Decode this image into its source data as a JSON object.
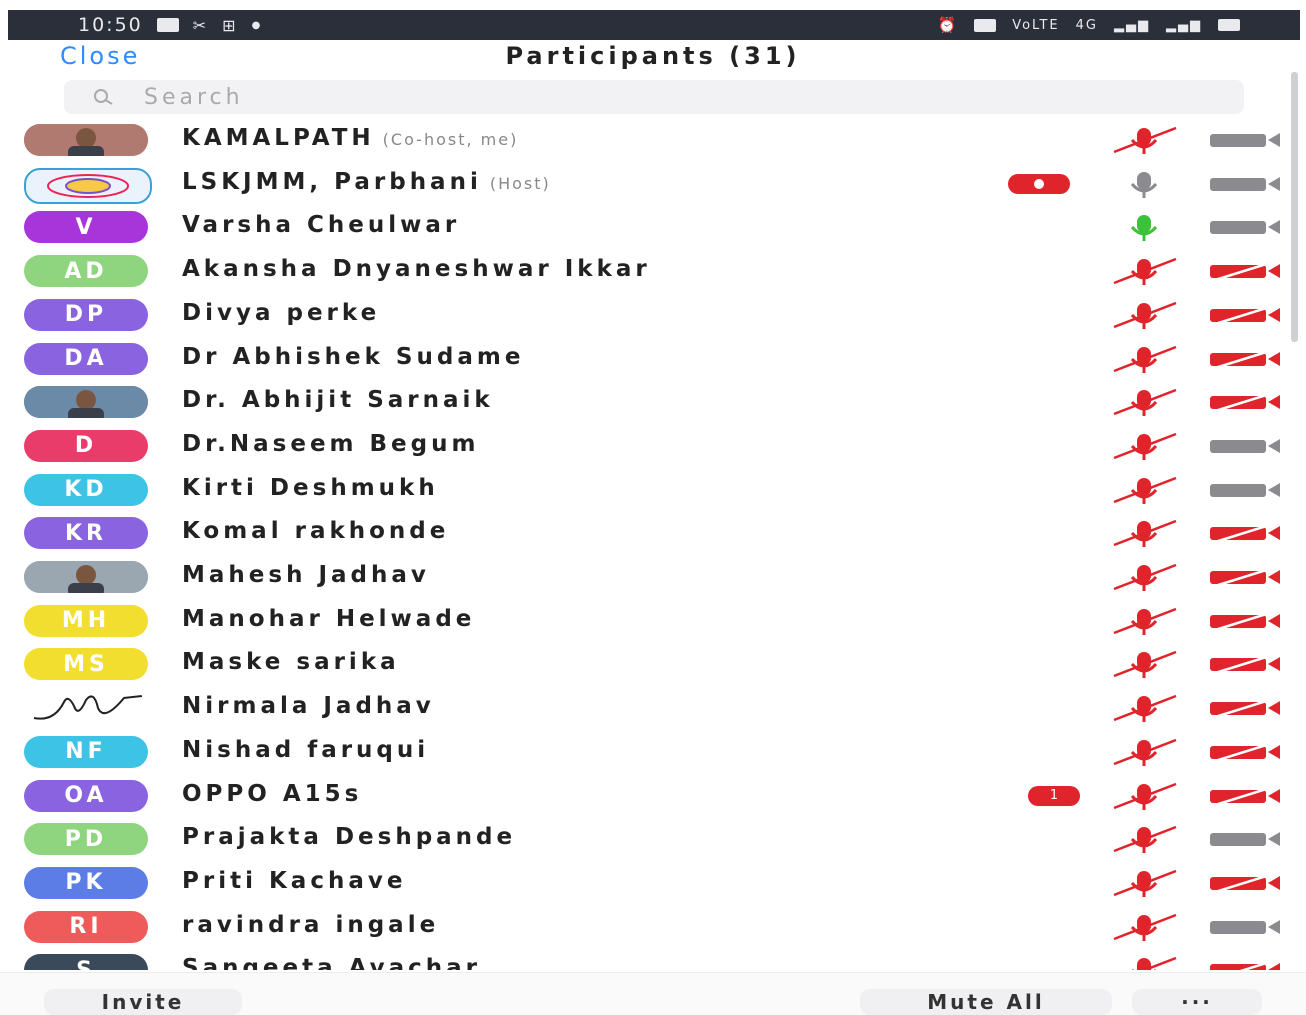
{
  "status_bar": {
    "time": "10:50",
    "network": "VoLTE",
    "signal_gen": "4G"
  },
  "header": {
    "close_label": "Close",
    "title": "Participants (31)"
  },
  "search": {
    "placeholder": "Search"
  },
  "colors": {
    "accent_blue": "#2d8cff",
    "muted_red": "#e0242b",
    "active_green": "#3cc13b",
    "neutral_grey": "#8a8a8f"
  },
  "participants": [
    {
      "name": "KAMALPATH",
      "role": "(Co-host, me)",
      "avatar_text": "",
      "avatar_color": "#b07a70",
      "avatar_kind": "photo-1",
      "badge": "",
      "mic": "muted",
      "video": "on"
    },
    {
      "name": "LSKJMM, Parbhani",
      "role": "(Host)",
      "avatar_text": "",
      "avatar_color": "#eaf3fb",
      "avatar_kind": "logo",
      "badge": "rec",
      "mic": "idle",
      "video": "on"
    },
    {
      "name": "Varsha Cheulwar",
      "role": "",
      "avatar_text": "V",
      "avatar_color": "#a735d9",
      "badge": "",
      "mic": "active",
      "video": "on"
    },
    {
      "name": "Akansha Dnyaneshwar Ikkar",
      "role": "",
      "avatar_text": "AD",
      "avatar_color": "#8fd47e",
      "badge": "",
      "mic": "muted",
      "video": "off"
    },
    {
      "name": "Divya perke",
      "role": "",
      "avatar_text": "DP",
      "avatar_color": "#8a63e0",
      "badge": "",
      "mic": "muted",
      "video": "off"
    },
    {
      "name": "Dr Abhishek Sudame",
      "role": "",
      "avatar_text": "DA",
      "avatar_color": "#8a63e0",
      "badge": "",
      "mic": "muted",
      "video": "off"
    },
    {
      "name": "Dr. Abhijit Sarnaik",
      "role": "",
      "avatar_text": "",
      "avatar_color": "#6a8aa8",
      "avatar_kind": "photo-2",
      "badge": "",
      "mic": "muted",
      "video": "off"
    },
    {
      "name": "Dr.Naseem Begum",
      "role": "",
      "avatar_text": "D",
      "avatar_color": "#ea3c6b",
      "badge": "",
      "mic": "muted",
      "video": "on"
    },
    {
      "name": "Kirti Deshmukh",
      "role": "",
      "avatar_text": "KD",
      "avatar_color": "#3cc3e6",
      "badge": "",
      "mic": "muted",
      "video": "on"
    },
    {
      "name": "Komal rakhonde",
      "role": "",
      "avatar_text": "KR",
      "avatar_color": "#8a63e0",
      "badge": "",
      "mic": "muted",
      "video": "off"
    },
    {
      "name": "Mahesh Jadhav",
      "role": "",
      "avatar_text": "",
      "avatar_color": "#9aa7b0",
      "avatar_kind": "photo-3",
      "badge": "",
      "mic": "muted",
      "video": "off"
    },
    {
      "name": "Manohar Helwade",
      "role": "",
      "avatar_text": "MH",
      "avatar_color": "#f2de2e",
      "badge": "",
      "mic": "muted",
      "video": "off"
    },
    {
      "name": "Maske sarika",
      "role": "",
      "avatar_text": "MS",
      "avatar_color": "#f2de2e",
      "badge": "",
      "mic": "muted",
      "video": "off"
    },
    {
      "name": "Nirmala Jadhav",
      "role": "",
      "avatar_text": "",
      "avatar_color": "#ffffff",
      "avatar_kind": "signature",
      "badge": "",
      "mic": "muted",
      "video": "off"
    },
    {
      "name": "Nishad faruqui",
      "role": "",
      "avatar_text": "NF",
      "avatar_color": "#3cc3e6",
      "badge": "",
      "mic": "muted",
      "video": "off"
    },
    {
      "name": "OPPO A15s",
      "role": "",
      "avatar_text": "OA",
      "avatar_color": "#8a63e0",
      "badge": "1",
      "mic": "muted",
      "video": "off"
    },
    {
      "name": "Prajakta Deshpande",
      "role": "",
      "avatar_text": "PD",
      "avatar_color": "#8fd47e",
      "badge": "",
      "mic": "muted",
      "video": "on"
    },
    {
      "name": "Priti Kachave",
      "role": "",
      "avatar_text": "PK",
      "avatar_color": "#5c7de6",
      "badge": "",
      "mic": "muted",
      "video": "off"
    },
    {
      "name": "ravindra ingale",
      "role": "",
      "avatar_text": "RI",
      "avatar_color": "#ef5a5a",
      "badge": "",
      "mic": "muted",
      "video": "on"
    },
    {
      "name": "Sangeeta Avachar",
      "role": "",
      "avatar_text": "S",
      "avatar_color": "#3b4a5a",
      "badge": "",
      "mic": "muted",
      "video": "off"
    }
  ],
  "footer": {
    "invite_label": "Invite",
    "mute_all_label": "Mute All",
    "more_label": "···"
  }
}
